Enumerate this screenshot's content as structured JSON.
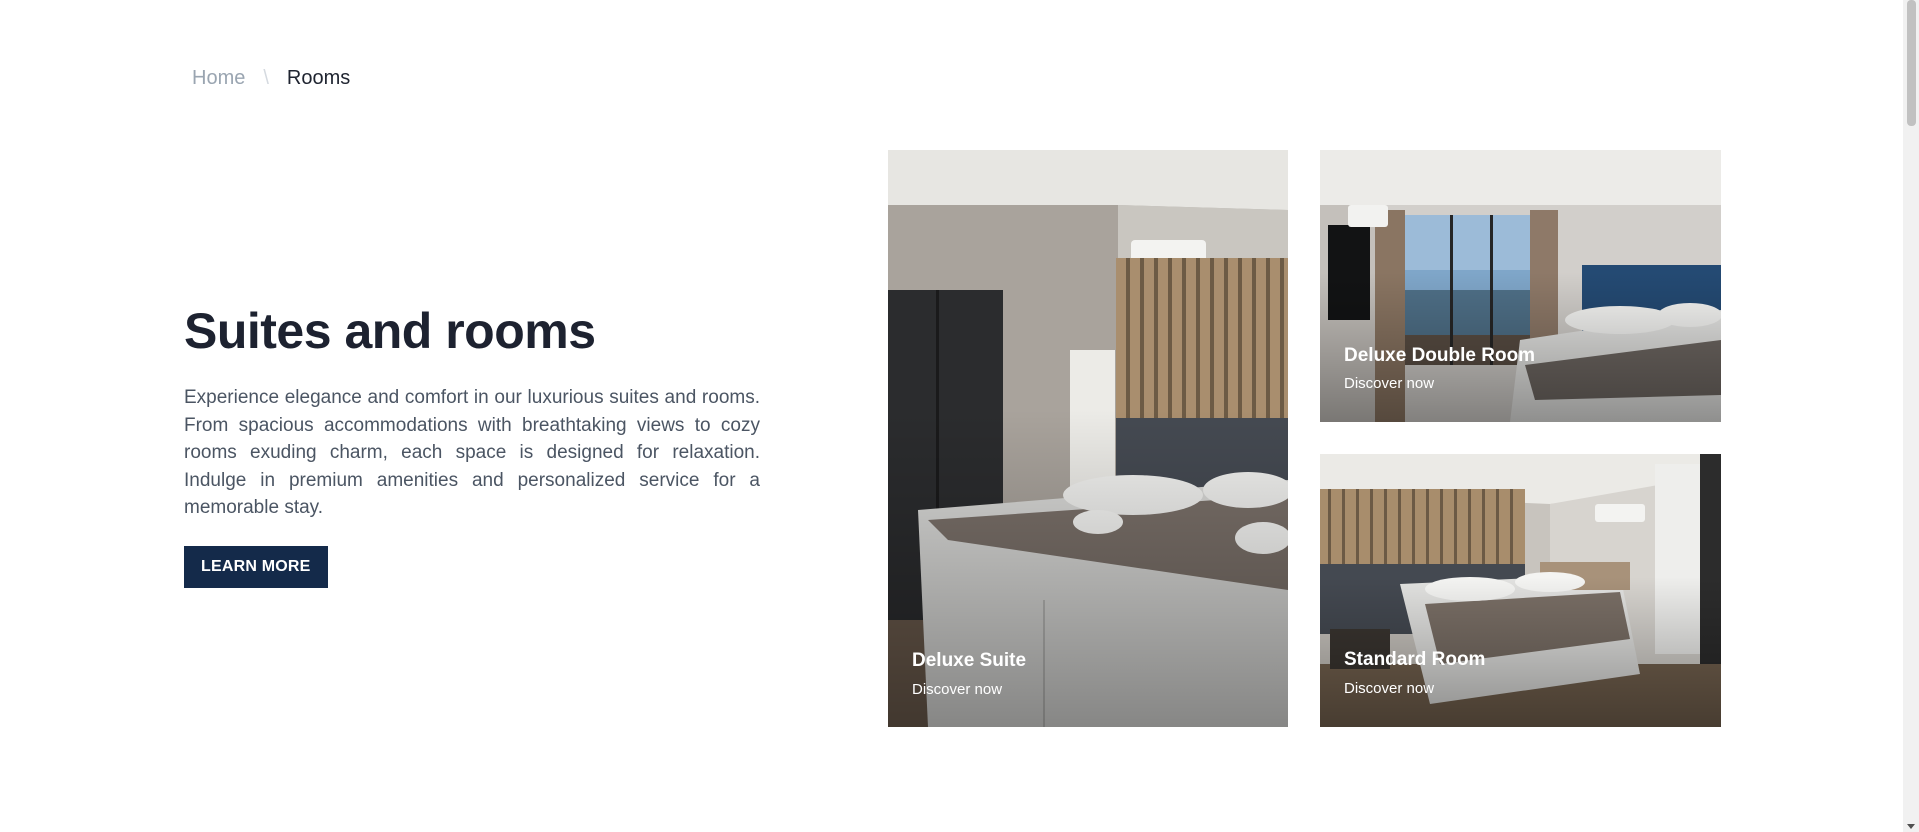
{
  "breadcrumb": {
    "home": "Home",
    "separator": "\\",
    "current": "Rooms"
  },
  "intro": {
    "title": "Suites and rooms",
    "description": "Experience elegance and comfort in our luxurious suites and rooms. From spacious accommodations with breathtaking views to cozy rooms exuding charm, each space is designed for relaxation. Indulge in premium amenities and personalized service for a memorable stay.",
    "button_label": "LEARN MORE"
  },
  "rooms": [
    {
      "name": "Deluxe Suite",
      "cta": "Discover now"
    },
    {
      "name": "Deluxe Double Room",
      "cta": "Discover now"
    },
    {
      "name": "Standard Room",
      "cta": "Discover now"
    }
  ],
  "colors": {
    "brand": "#142a4a",
    "heading": "#1d2230",
    "muted": "#9aa5b1"
  }
}
